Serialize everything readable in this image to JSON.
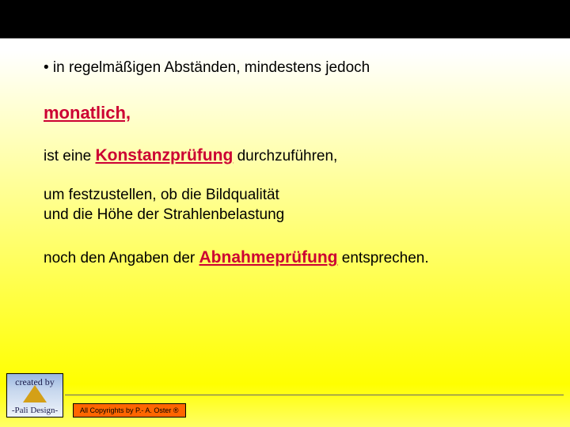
{
  "content": {
    "bullet1": "• in regelmäßigen Abständen, mindestens jedoch",
    "emph_monatlich": "monatlich,",
    "line3_pre": "ist eine ",
    "emph_konstanz": "Konstanzprüfung",
    "line3_post": " durchzuführen,",
    "line4a": "um festzustellen, ob die Bildqualität",
    "line4b": "und die Höhe der Strahlenbelastung",
    "line5_pre": "noch den Angaben der ",
    "emph_abnahme": "Abnahmeprüfung",
    "line5_post": " entsprechen."
  },
  "footer": {
    "logo_top": "created by",
    "logo_bottom": "-Pali Design-",
    "copyright": "All Copyrights by P.- A. Oster ®"
  }
}
